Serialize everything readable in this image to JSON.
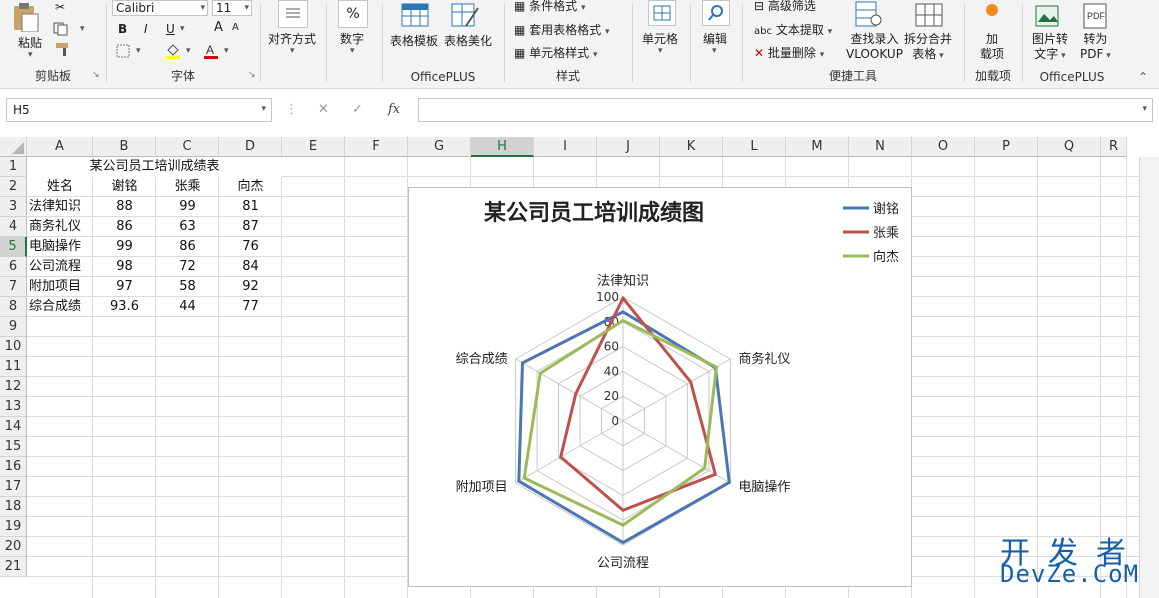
{
  "ribbon": {
    "clipboard": {
      "paste": "粘贴",
      "label": "剪贴板"
    },
    "font": {
      "name": "Calibri",
      "size": "11",
      "bold": "B",
      "italic": "I",
      "underline": "U",
      "label": "字体",
      "grow": "A",
      "shrink": "A"
    },
    "alignment": {
      "label": "对齐方式"
    },
    "number": {
      "label": "数字",
      "symbol": "%"
    },
    "officeplus": {
      "template": "表格模板",
      "beautify": "表格美化",
      "label": "OfficePLUS"
    },
    "styles": {
      "conditional": "条件格式",
      "table_format": "套用表格格式",
      "cell_style": "单元格样式",
      "label": "样式"
    },
    "cells": {
      "label": "单元格"
    },
    "editing": {
      "label": "编辑"
    },
    "quick_tools": {
      "advanced_filter": "高级筛选",
      "text_extract": "文本提取",
      "batch_delete": "批量删除",
      "vlookup_1": "查找录入",
      "vlookup_2": "VLOOKUP",
      "split_1": "拆分合并",
      "split_2": "表格",
      "label": "便捷工具"
    },
    "addins": {
      "add_1": "加",
      "add_2": "载项",
      "label": "加载项"
    },
    "officeplus2": {
      "pic_1": "图片转",
      "pic_2": "文字",
      "pdf_1": "转为",
      "pdf_2": "PDF",
      "pdf_icon": "PDF",
      "label": "OfficePLUS"
    }
  },
  "formula_bar": {
    "name_box": "H5",
    "fx": "fx",
    "cancel": "✕",
    "confirm": "✓",
    "value": ""
  },
  "columns": [
    "A",
    "B",
    "C",
    "D",
    "E",
    "F",
    "G",
    "H",
    "I",
    "J",
    "K",
    "L",
    "M",
    "N",
    "O",
    "P",
    "Q",
    "R"
  ],
  "rows": [
    "1",
    "2",
    "3",
    "4",
    "5",
    "6",
    "7",
    "8",
    "9",
    "10",
    "11",
    "12",
    "13",
    "14",
    "15",
    "16",
    "17",
    "18",
    "19",
    "20",
    "21"
  ],
  "selected_cell": "H5",
  "table": {
    "title": "某公司员工培训成绩表",
    "headers": [
      "姓名",
      "谢铭",
      "张乘",
      "向杰"
    ],
    "rows": [
      [
        "法律知识",
        "88",
        "99",
        "81"
      ],
      [
        "商务礼仪",
        "86",
        "63",
        "87"
      ],
      [
        "电脑操作",
        "99",
        "86",
        "76"
      ],
      [
        "公司流程",
        "98",
        "72",
        "84"
      ],
      [
        "附加项目",
        "97",
        "58",
        "92"
      ],
      [
        "综合成绩",
        "93.6",
        "44",
        "77"
      ]
    ]
  },
  "chart_data": {
    "type": "radar",
    "title": "某公司员工培训成绩图",
    "categories": [
      "法律知识",
      "商务礼仪",
      "电脑操作",
      "公司流程",
      "附加项目",
      "综合成绩"
    ],
    "rmin": 0,
    "rmax": 100,
    "ticks": [
      "0",
      "20",
      "40",
      "60",
      "80",
      "100"
    ],
    "tick_values": [
      0,
      20,
      40,
      60,
      80,
      100
    ],
    "grid": true,
    "legend_position": "top-right",
    "series": [
      {
        "name": "谢铭",
        "color": "#4a76b4",
        "values": [
          88,
          86,
          99,
          98,
          97,
          93.6
        ]
      },
      {
        "name": "张乘",
        "color": "#c0504d",
        "values": [
          99,
          63,
          86,
          72,
          58,
          44
        ]
      },
      {
        "name": "向杰",
        "color": "#9bbb59",
        "values": [
          81,
          87,
          76,
          84,
          92,
          77
        ]
      }
    ]
  },
  "watermark": {
    "line1": "开发者",
    "line2": "DevZe.CoM"
  },
  "colors": {
    "accent": "#217346",
    "grid": "#d4d4d4",
    "header_bg": "#efefef"
  }
}
